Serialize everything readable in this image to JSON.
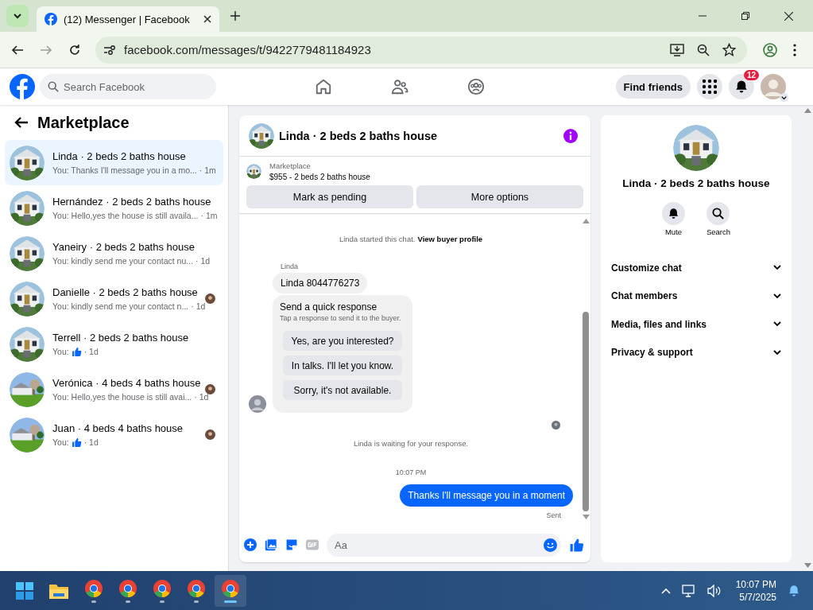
{
  "browser": {
    "tab_title": "(12) Messenger | Facebook",
    "url": "facebook.com/messages/t/9422779481184923"
  },
  "header": {
    "search_placeholder": "Search Facebook",
    "find_friends": "Find friends",
    "notifications": "12"
  },
  "sidebar": {
    "title": "Marketplace",
    "conversations": [
      {
        "title": "Linda · 2 beds 2 baths house",
        "kind": "text",
        "preview": "You: Thanks I'll message you in a mo...",
        "time": "· 1m",
        "selected": true,
        "seen": false
      },
      {
        "title": "Hernández · 2 beds 2 baths house",
        "kind": "text",
        "preview": "You: Hello,yes the house is still availa...",
        "time": "· 1m",
        "selected": false,
        "seen": false
      },
      {
        "title": "Yaneiry · 2 beds 2 baths house",
        "kind": "text",
        "preview": "You: kindly send me your contact nu...",
        "time": "· 1d",
        "selected": false,
        "seen": false
      },
      {
        "title": "Danielle · 2 beds 2 baths house",
        "kind": "text",
        "preview": "You: kindly send me your contact n...",
        "time": "· 1d",
        "selected": false,
        "seen": true
      },
      {
        "title": "Terrell · 2 beds 2 baths house",
        "kind": "like",
        "preview": "You:",
        "time": "· 1d",
        "selected": false,
        "seen": false
      },
      {
        "title": "Verónica · 4 beds 4 baths house",
        "kind": "text",
        "preview": "You: Hello,yes the house is still avai...",
        "time": "· 1d",
        "selected": false,
        "seen": true
      },
      {
        "title": "Juan · 4 beds 4 baths house",
        "kind": "like",
        "preview": "You:",
        "time": "· 1d",
        "selected": false,
        "seen": true
      }
    ]
  },
  "chat": {
    "title": "Linda · 2 beds 2 baths house",
    "listing": {
      "label": "Marketplace",
      "item": "$955 - 2 beds 2 baths house"
    },
    "actions": [
      "Mark as pending",
      "More options"
    ],
    "messages": [
      {
        "kind": "notice",
        "text": "Linda started this chat.",
        "link": "View buyer profile"
      },
      {
        "kind": "sender",
        "text": "Linda"
      },
      {
        "kind": "incoming",
        "text": "Linda 8044776273"
      },
      {
        "kind": "quick",
        "title": "Send a quick response",
        "subtitle": "Tap a response to send it to the buyer.",
        "options": [
          "Yes, are you interested?",
          "In talks. I'll let you know.",
          "Sorry, it's not available."
        ]
      },
      {
        "kind": "seen"
      },
      {
        "kind": "notice",
        "text": "Linda is waiting for your response."
      },
      {
        "kind": "time",
        "text": "10:07 PM"
      },
      {
        "kind": "outgoing",
        "text": "Thanks I'll message you in a moment"
      },
      {
        "kind": "status",
        "text": "Sent"
      }
    ],
    "composer_placeholder": "Aa"
  },
  "details": {
    "title": "Linda · 2 beds 2 baths house",
    "actions": [
      {
        "label": "Mute",
        "kind": "bell"
      },
      {
        "label": "Search",
        "kind": "search"
      }
    ],
    "sections": [
      "Customize chat",
      "Chat members",
      "Media, files and links",
      "Privacy & support"
    ]
  },
  "taskbar": {
    "time": "10:07 PM",
    "date": "5/7/2025"
  }
}
